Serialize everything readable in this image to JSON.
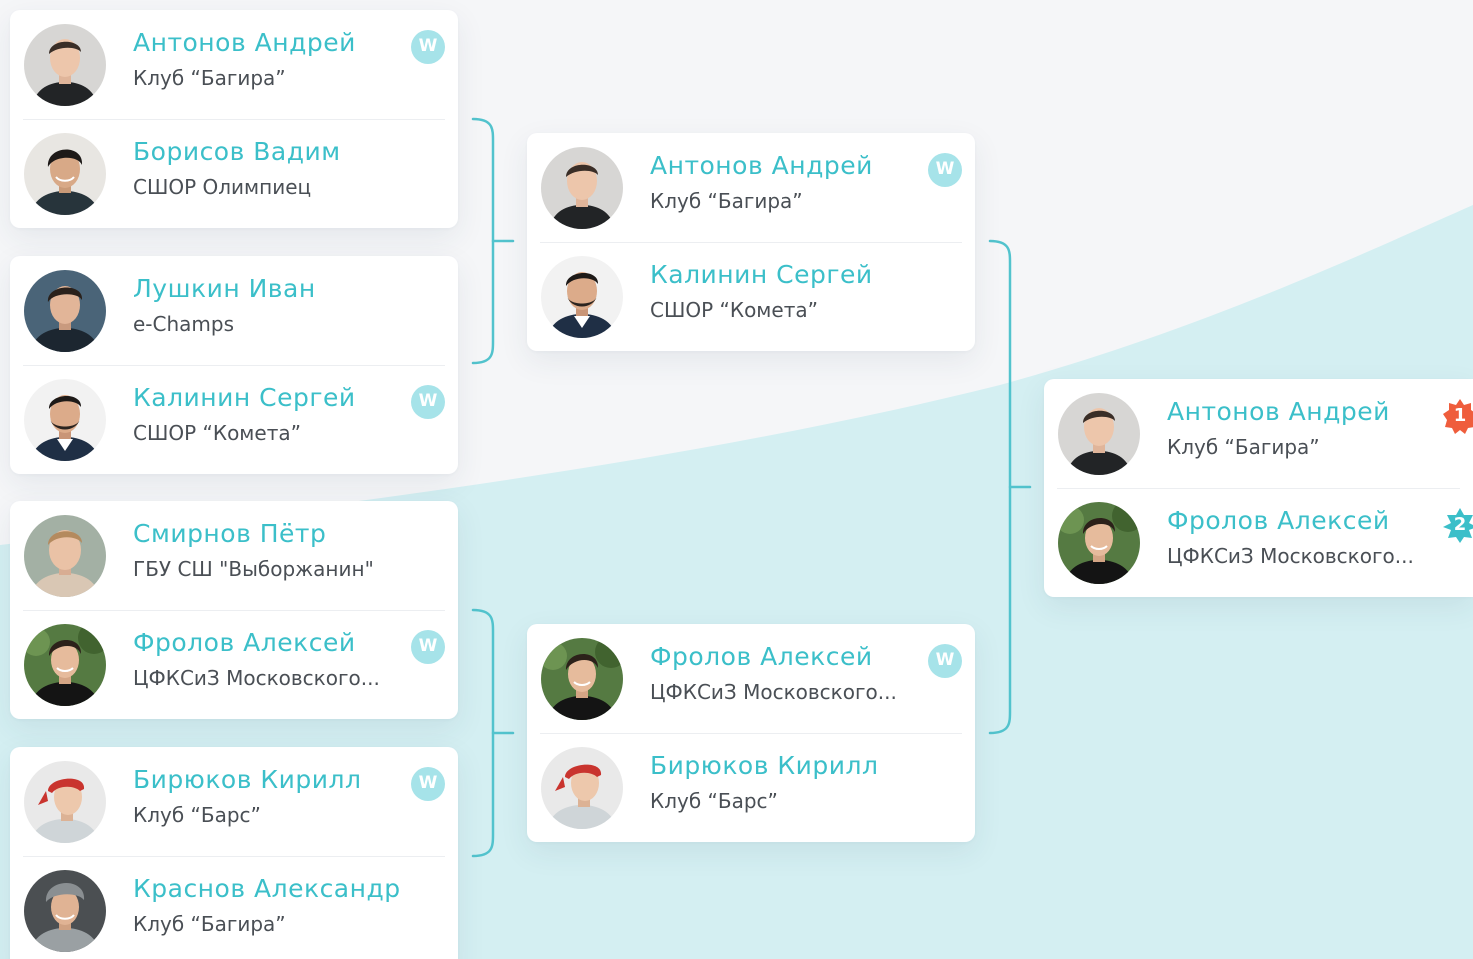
{
  "bracket": {
    "round_1": [
      {
        "top": {
          "name": "Антонов Андрей",
          "club": "Клуб “Багира”",
          "winner_badge": "W",
          "avatar": "avatar-antonov"
        },
        "bottom": {
          "name": "Борисов Вадим",
          "club": "СШОР Олимпиец",
          "winner_badge": "",
          "avatar": "avatar-borisov"
        }
      },
      {
        "top": {
          "name": "Лушкин Иван",
          "club": "e-Champs",
          "winner_badge": "",
          "avatar": "avatar-lushkin"
        },
        "bottom": {
          "name": "Калинин Сергей",
          "club": "СШОР “Комета”",
          "winner_badge": "W",
          "avatar": "avatar-kalinin"
        }
      },
      {
        "top": {
          "name": "Смирнов Пётр",
          "club": "ГБУ СШ \"Выборжанин\"",
          "winner_badge": "",
          "avatar": "avatar-smirnov"
        },
        "bottom": {
          "name": "Фролов Алексей",
          "club": "ЦФКСиЗ Московского...",
          "winner_badge": "W",
          "avatar": "avatar-frolov"
        }
      },
      {
        "top": {
          "name": "Бирюков Кирилл",
          "club": "Клуб “Барс”",
          "winner_badge": "W",
          "avatar": "avatar-biryukov"
        },
        "bottom": {
          "name": "Краснов Александр",
          "club": "Клуб “Багира”",
          "winner_badge": "",
          "avatar": "avatar-krasnov"
        }
      }
    ],
    "round_2": [
      {
        "top": {
          "name": "Антонов Андрей",
          "club": "Клуб “Багира”",
          "winner_badge": "W",
          "avatar": "avatar-antonov"
        },
        "bottom": {
          "name": "Калинин Сергей",
          "club": "СШОР “Комета”",
          "winner_badge": "",
          "avatar": "avatar-kalinin"
        }
      },
      {
        "top": {
          "name": "Фролов Алексей",
          "club": "ЦФКСиЗ Московского...",
          "winner_badge": "W",
          "avatar": "avatar-frolov"
        },
        "bottom": {
          "name": "Бирюков Кирилл",
          "club": "Клуб “Барс”",
          "winner_badge": "",
          "avatar": "avatar-biryukov"
        }
      }
    ],
    "final": {
      "top": {
        "name": "Антонов Андрей",
        "club": "Клуб “Багира”",
        "place": "1",
        "avatar": "avatar-antonov"
      },
      "bottom": {
        "name": "Фролов Алексей",
        "club": "ЦФКСиЗ Московского...",
        "place": "2",
        "avatar": "avatar-frolov"
      }
    }
  },
  "colors": {
    "accent": "#3bbfc9",
    "connector": "#52c3cd",
    "winner_badge": "#a6e3e9",
    "first_place_badge": "#ef5d3c",
    "second_place_badge": "#3bbfc9",
    "background_wave": "#d4eff2",
    "background": "#f5f6f8",
    "club_text": "#4a4f55"
  }
}
